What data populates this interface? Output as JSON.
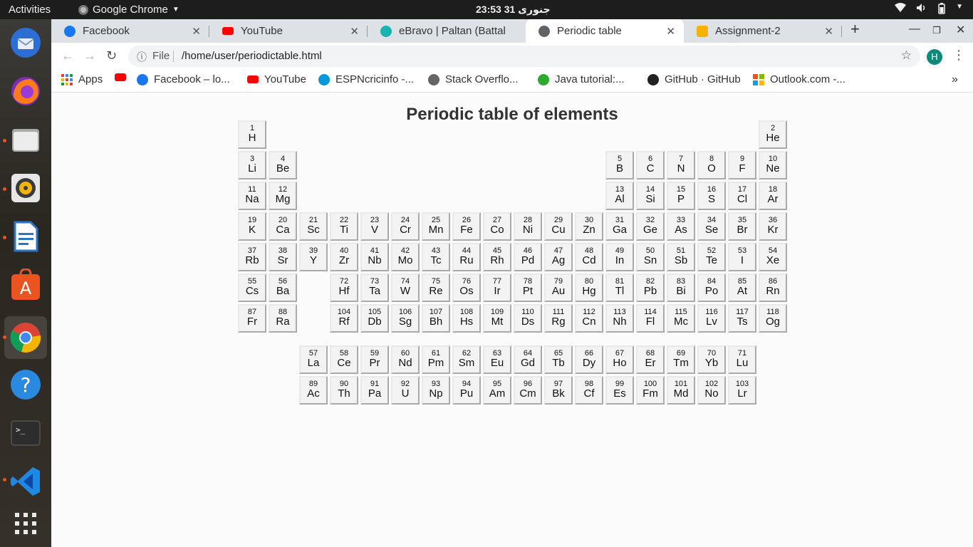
{
  "topbar": {
    "activities": "Activities",
    "app_name": "Google Chrome",
    "clock": "23:53  31 جنوری"
  },
  "dock": {
    "items": [
      "thunderbird-icon",
      "firefox-icon",
      "files-icon",
      "rhythmbox-icon",
      "libreoffice-writer-icon",
      "software-center-icon",
      "chrome-icon",
      "help-icon",
      "terminal-icon",
      "vscode-icon",
      "show-apps-icon"
    ]
  },
  "tabs": [
    {
      "title": "Facebook",
      "color": "#1877f2"
    },
    {
      "title": "YouTube",
      "color": "#ff0000"
    },
    {
      "title": "eBravo | Paltan (Battali",
      "color": "#19b3b3"
    },
    {
      "title": "Periodic table",
      "color": "#5f6368"
    },
    {
      "title": "Assignment-2",
      "color": "#f4b400"
    }
  ],
  "toolbar": {
    "scheme": "File",
    "url": "/home/user/periodictable.html",
    "avatar_letter": "H"
  },
  "bookmarks": [
    {
      "label": "Apps"
    },
    {
      "label": ""
    },
    {
      "label": "Facebook – lo..."
    },
    {
      "label": "YouTube"
    },
    {
      "label": "ESPNcricinfo -..."
    },
    {
      "label": "Stack Overflo..."
    },
    {
      "label": "Java tutorial:..."
    },
    {
      "label": "GitHub · GitHub"
    },
    {
      "label": "Outlook.com -..."
    }
  ],
  "page": {
    "title": "Periodic table of elements"
  },
  "elements": [
    {
      "n": "1",
      "s": "H",
      "r": 0,
      "c": 0
    },
    {
      "n": "2",
      "s": "He",
      "r": 0,
      "c": 17
    },
    {
      "n": "3",
      "s": "Li",
      "r": 1,
      "c": 0
    },
    {
      "n": "4",
      "s": "Be",
      "r": 1,
      "c": 1
    },
    {
      "n": "5",
      "s": "B",
      "r": 1,
      "c": 12
    },
    {
      "n": "6",
      "s": "C",
      "r": 1,
      "c": 13
    },
    {
      "n": "7",
      "s": "N",
      "r": 1,
      "c": 14
    },
    {
      "n": "8",
      "s": "O",
      "r": 1,
      "c": 15
    },
    {
      "n": "9",
      "s": "F",
      "r": 1,
      "c": 16
    },
    {
      "n": "10",
      "s": "Ne",
      "r": 1,
      "c": 17
    },
    {
      "n": "11",
      "s": "Na",
      "r": 2,
      "c": 0
    },
    {
      "n": "12",
      "s": "Mg",
      "r": 2,
      "c": 1
    },
    {
      "n": "13",
      "s": "Al",
      "r": 2,
      "c": 12
    },
    {
      "n": "14",
      "s": "Si",
      "r": 2,
      "c": 13
    },
    {
      "n": "15",
      "s": "P",
      "r": 2,
      "c": 14
    },
    {
      "n": "16",
      "s": "S",
      "r": 2,
      "c": 15
    },
    {
      "n": "17",
      "s": "Cl",
      "r": 2,
      "c": 16
    },
    {
      "n": "18",
      "s": "Ar",
      "r": 2,
      "c": 17
    },
    {
      "n": "19",
      "s": "K",
      "r": 3,
      "c": 0
    },
    {
      "n": "20",
      "s": "Ca",
      "r": 3,
      "c": 1
    },
    {
      "n": "21",
      "s": "Sc",
      "r": 3,
      "c": 2
    },
    {
      "n": "22",
      "s": "Ti",
      "r": 3,
      "c": 3
    },
    {
      "n": "23",
      "s": "V",
      "r": 3,
      "c": 4
    },
    {
      "n": "24",
      "s": "Cr",
      "r": 3,
      "c": 5
    },
    {
      "n": "25",
      "s": "Mn",
      "r": 3,
      "c": 6
    },
    {
      "n": "26",
      "s": "Fe",
      "r": 3,
      "c": 7
    },
    {
      "n": "27",
      "s": "Co",
      "r": 3,
      "c": 8
    },
    {
      "n": "28",
      "s": "Ni",
      "r": 3,
      "c": 9
    },
    {
      "n": "29",
      "s": "Cu",
      "r": 3,
      "c": 10
    },
    {
      "n": "30",
      "s": "Zn",
      "r": 3,
      "c": 11
    },
    {
      "n": "31",
      "s": "Ga",
      "r": 3,
      "c": 12
    },
    {
      "n": "32",
      "s": "Ge",
      "r": 3,
      "c": 13
    },
    {
      "n": "33",
      "s": "As",
      "r": 3,
      "c": 14
    },
    {
      "n": "34",
      "s": "Se",
      "r": 3,
      "c": 15
    },
    {
      "n": "35",
      "s": "Br",
      "r": 3,
      "c": 16
    },
    {
      "n": "36",
      "s": "Kr",
      "r": 3,
      "c": 17
    },
    {
      "n": "37",
      "s": "Rb",
      "r": 4,
      "c": 0
    },
    {
      "n": "38",
      "s": "Sr",
      "r": 4,
      "c": 1
    },
    {
      "n": "39",
      "s": "Y",
      "r": 4,
      "c": 2
    },
    {
      "n": "40",
      "s": "Zr",
      "r": 4,
      "c": 3
    },
    {
      "n": "41",
      "s": "Nb",
      "r": 4,
      "c": 4
    },
    {
      "n": "42",
      "s": "Mo",
      "r": 4,
      "c": 5
    },
    {
      "n": "43",
      "s": "Tc",
      "r": 4,
      "c": 6
    },
    {
      "n": "44",
      "s": "Ru",
      "r": 4,
      "c": 7
    },
    {
      "n": "45",
      "s": "Rh",
      "r": 4,
      "c": 8
    },
    {
      "n": "46",
      "s": "Pd",
      "r": 4,
      "c": 9
    },
    {
      "n": "47",
      "s": "Ag",
      "r": 4,
      "c": 10
    },
    {
      "n": "48",
      "s": "Cd",
      "r": 4,
      "c": 11
    },
    {
      "n": "49",
      "s": "In",
      "r": 4,
      "c": 12
    },
    {
      "n": "50",
      "s": "Sn",
      "r": 4,
      "c": 13
    },
    {
      "n": "51",
      "s": "Sb",
      "r": 4,
      "c": 14
    },
    {
      "n": "52",
      "s": "Te",
      "r": 4,
      "c": 15
    },
    {
      "n": "53",
      "s": "I",
      "r": 4,
      "c": 16
    },
    {
      "n": "54",
      "s": "Xe",
      "r": 4,
      "c": 17
    },
    {
      "n": "55",
      "s": "Cs",
      "r": 5,
      "c": 0
    },
    {
      "n": "56",
      "s": "Ba",
      "r": 5,
      "c": 1
    },
    {
      "n": "72",
      "s": "Hf",
      "r": 5,
      "c": 3
    },
    {
      "n": "73",
      "s": "Ta",
      "r": 5,
      "c": 4
    },
    {
      "n": "74",
      "s": "W",
      "r": 5,
      "c": 5
    },
    {
      "n": "75",
      "s": "Re",
      "r": 5,
      "c": 6
    },
    {
      "n": "76",
      "s": "Os",
      "r": 5,
      "c": 7
    },
    {
      "n": "77",
      "s": "Ir",
      "r": 5,
      "c": 8
    },
    {
      "n": "78",
      "s": "Pt",
      "r": 5,
      "c": 9
    },
    {
      "n": "79",
      "s": "Au",
      "r": 5,
      "c": 10
    },
    {
      "n": "80",
      "s": "Hg",
      "r": 5,
      "c": 11
    },
    {
      "n": "81",
      "s": "Tl",
      "r": 5,
      "c": 12
    },
    {
      "n": "82",
      "s": "Pb",
      "r": 5,
      "c": 13
    },
    {
      "n": "83",
      "s": "Bi",
      "r": 5,
      "c": 14
    },
    {
      "n": "84",
      "s": "Po",
      "r": 5,
      "c": 15
    },
    {
      "n": "85",
      "s": "At",
      "r": 5,
      "c": 16
    },
    {
      "n": "86",
      "s": "Rn",
      "r": 5,
      "c": 17
    },
    {
      "n": "87",
      "s": "Fr",
      "r": 6,
      "c": 0
    },
    {
      "n": "88",
      "s": "Ra",
      "r": 6,
      "c": 1
    },
    {
      "n": "104",
      "s": "Rf",
      "r": 6,
      "c": 3
    },
    {
      "n": "105",
      "s": "Db",
      "r": 6,
      "c": 4
    },
    {
      "n": "106",
      "s": "Sg",
      "r": 6,
      "c": 5
    },
    {
      "n": "107",
      "s": "Bh",
      "r": 6,
      "c": 6
    },
    {
      "n": "108",
      "s": "Hs",
      "r": 6,
      "c": 7
    },
    {
      "n": "109",
      "s": "Mt",
      "r": 6,
      "c": 8
    },
    {
      "n": "110",
      "s": "Ds",
      "r": 6,
      "c": 9
    },
    {
      "n": "111",
      "s": "Rg",
      "r": 6,
      "c": 10
    },
    {
      "n": "112",
      "s": "Cn",
      "r": 6,
      "c": 11
    },
    {
      "n": "113",
      "s": "Nh",
      "r": 6,
      "c": 12
    },
    {
      "n": "114",
      "s": "Fl",
      "r": 6,
      "c": 13
    },
    {
      "n": "115",
      "s": "Mc",
      "r": 6,
      "c": 14
    },
    {
      "n": "116",
      "s": "Lv",
      "r": 6,
      "c": 15
    },
    {
      "n": "117",
      "s": "Ts",
      "r": 6,
      "c": 16
    },
    {
      "n": "118",
      "s": "Og",
      "r": 6,
      "c": 17
    },
    {
      "n": "57",
      "s": "La",
      "r": 7,
      "c": 2
    },
    {
      "n": "58",
      "s": "Ce",
      "r": 7,
      "c": 3
    },
    {
      "n": "59",
      "s": "Pr",
      "r": 7,
      "c": 4
    },
    {
      "n": "60",
      "s": "Nd",
      "r": 7,
      "c": 5
    },
    {
      "n": "61",
      "s": "Pm",
      "r": 7,
      "c": 6
    },
    {
      "n": "62",
      "s": "Sm",
      "r": 7,
      "c": 7
    },
    {
      "n": "63",
      "s": "Eu",
      "r": 7,
      "c": 8
    },
    {
      "n": "64",
      "s": "Gd",
      "r": 7,
      "c": 9
    },
    {
      "n": "65",
      "s": "Tb",
      "r": 7,
      "c": 10
    },
    {
      "n": "66",
      "s": "Dy",
      "r": 7,
      "c": 11
    },
    {
      "n": "67",
      "s": "Ho",
      "r": 7,
      "c": 12
    },
    {
      "n": "68",
      "s": "Er",
      "r": 7,
      "c": 13
    },
    {
      "n": "69",
      "s": "Tm",
      "r": 7,
      "c": 14
    },
    {
      "n": "70",
      "s": "Yb",
      "r": 7,
      "c": 15
    },
    {
      "n": "71",
      "s": "Lu",
      "r": 7,
      "c": 16
    },
    {
      "n": "89",
      "s": "Ac",
      "r": 8,
      "c": 2
    },
    {
      "n": "90",
      "s": "Th",
      "r": 8,
      "c": 3
    },
    {
      "n": "91",
      "s": "Pa",
      "r": 8,
      "c": 4
    },
    {
      "n": "92",
      "s": "U",
      "r": 8,
      "c": 5
    },
    {
      "n": "93",
      "s": "Np",
      "r": 8,
      "c": 6
    },
    {
      "n": "94",
      "s": "Pu",
      "r": 8,
      "c": 7
    },
    {
      "n": "95",
      "s": "Am",
      "r": 8,
      "c": 8
    },
    {
      "n": "96",
      "s": "Cm",
      "r": 8,
      "c": 9
    },
    {
      "n": "97",
      "s": "Bk",
      "r": 8,
      "c": 10
    },
    {
      "n": "98",
      "s": "Cf",
      "r": 8,
      "c": 11
    },
    {
      "n": "99",
      "s": "Es",
      "r": 8,
      "c": 12
    },
    {
      "n": "100",
      "s": "Fm",
      "r": 8,
      "c": 13
    },
    {
      "n": "101",
      "s": "Md",
      "r": 8,
      "c": 14
    },
    {
      "n": "102",
      "s": "No",
      "r": 8,
      "c": 15
    },
    {
      "n": "103",
      "s": "Lr",
      "r": 8,
      "c": 16
    }
  ]
}
